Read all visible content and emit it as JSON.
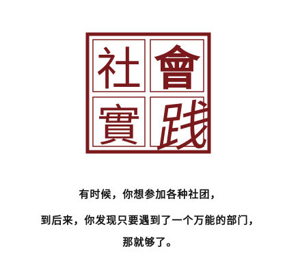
{
  "logo": {
    "characters": [
      "社",
      "會",
      "實",
      "践"
    ],
    "primary_color": "#7a1a1c"
  },
  "caption": {
    "line1": "有时候，你想参加各种社团，",
    "line2": "到后来，你发现只要遇到了一个万能的部门，",
    "line3": "那就够了。"
  }
}
